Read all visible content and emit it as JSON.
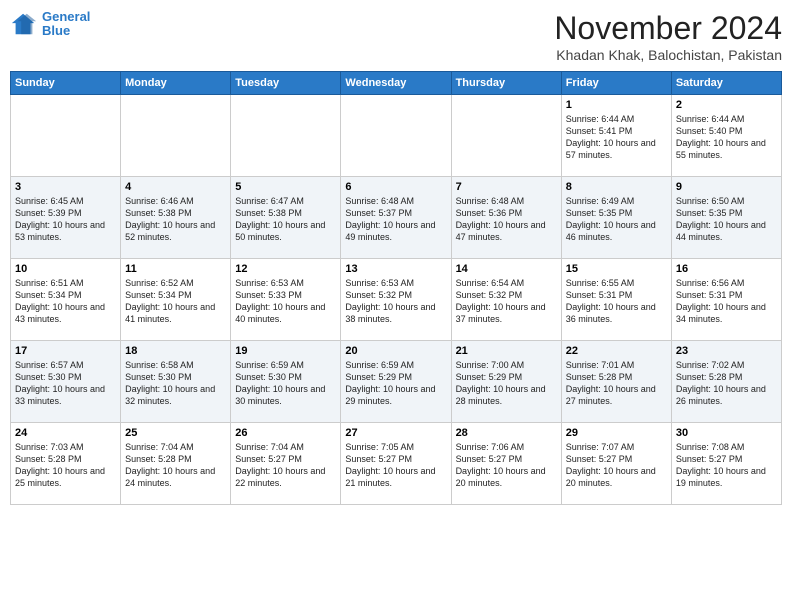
{
  "header": {
    "logo_line1": "General",
    "logo_line2": "Blue",
    "title": "November 2024",
    "subtitle": "Khadan Khak, Balochistan, Pakistan"
  },
  "weekdays": [
    "Sunday",
    "Monday",
    "Tuesday",
    "Wednesday",
    "Thursday",
    "Friday",
    "Saturday"
  ],
  "weeks": [
    [
      {
        "day": "",
        "info": ""
      },
      {
        "day": "",
        "info": ""
      },
      {
        "day": "",
        "info": ""
      },
      {
        "day": "",
        "info": ""
      },
      {
        "day": "",
        "info": ""
      },
      {
        "day": "1",
        "info": "Sunrise: 6:44 AM\nSunset: 5:41 PM\nDaylight: 10 hours and 57 minutes."
      },
      {
        "day": "2",
        "info": "Sunrise: 6:44 AM\nSunset: 5:40 PM\nDaylight: 10 hours and 55 minutes."
      }
    ],
    [
      {
        "day": "3",
        "info": "Sunrise: 6:45 AM\nSunset: 5:39 PM\nDaylight: 10 hours and 53 minutes."
      },
      {
        "day": "4",
        "info": "Sunrise: 6:46 AM\nSunset: 5:38 PM\nDaylight: 10 hours and 52 minutes."
      },
      {
        "day": "5",
        "info": "Sunrise: 6:47 AM\nSunset: 5:38 PM\nDaylight: 10 hours and 50 minutes."
      },
      {
        "day": "6",
        "info": "Sunrise: 6:48 AM\nSunset: 5:37 PM\nDaylight: 10 hours and 49 minutes."
      },
      {
        "day": "7",
        "info": "Sunrise: 6:48 AM\nSunset: 5:36 PM\nDaylight: 10 hours and 47 minutes."
      },
      {
        "day": "8",
        "info": "Sunrise: 6:49 AM\nSunset: 5:35 PM\nDaylight: 10 hours and 46 minutes."
      },
      {
        "day": "9",
        "info": "Sunrise: 6:50 AM\nSunset: 5:35 PM\nDaylight: 10 hours and 44 minutes."
      }
    ],
    [
      {
        "day": "10",
        "info": "Sunrise: 6:51 AM\nSunset: 5:34 PM\nDaylight: 10 hours and 43 minutes."
      },
      {
        "day": "11",
        "info": "Sunrise: 6:52 AM\nSunset: 5:34 PM\nDaylight: 10 hours and 41 minutes."
      },
      {
        "day": "12",
        "info": "Sunrise: 6:53 AM\nSunset: 5:33 PM\nDaylight: 10 hours and 40 minutes."
      },
      {
        "day": "13",
        "info": "Sunrise: 6:53 AM\nSunset: 5:32 PM\nDaylight: 10 hours and 38 minutes."
      },
      {
        "day": "14",
        "info": "Sunrise: 6:54 AM\nSunset: 5:32 PM\nDaylight: 10 hours and 37 minutes."
      },
      {
        "day": "15",
        "info": "Sunrise: 6:55 AM\nSunset: 5:31 PM\nDaylight: 10 hours and 36 minutes."
      },
      {
        "day": "16",
        "info": "Sunrise: 6:56 AM\nSunset: 5:31 PM\nDaylight: 10 hours and 34 minutes."
      }
    ],
    [
      {
        "day": "17",
        "info": "Sunrise: 6:57 AM\nSunset: 5:30 PM\nDaylight: 10 hours and 33 minutes."
      },
      {
        "day": "18",
        "info": "Sunrise: 6:58 AM\nSunset: 5:30 PM\nDaylight: 10 hours and 32 minutes."
      },
      {
        "day": "19",
        "info": "Sunrise: 6:59 AM\nSunset: 5:30 PM\nDaylight: 10 hours and 30 minutes."
      },
      {
        "day": "20",
        "info": "Sunrise: 6:59 AM\nSunset: 5:29 PM\nDaylight: 10 hours and 29 minutes."
      },
      {
        "day": "21",
        "info": "Sunrise: 7:00 AM\nSunset: 5:29 PM\nDaylight: 10 hours and 28 minutes."
      },
      {
        "day": "22",
        "info": "Sunrise: 7:01 AM\nSunset: 5:28 PM\nDaylight: 10 hours and 27 minutes."
      },
      {
        "day": "23",
        "info": "Sunrise: 7:02 AM\nSunset: 5:28 PM\nDaylight: 10 hours and 26 minutes."
      }
    ],
    [
      {
        "day": "24",
        "info": "Sunrise: 7:03 AM\nSunset: 5:28 PM\nDaylight: 10 hours and 25 minutes."
      },
      {
        "day": "25",
        "info": "Sunrise: 7:04 AM\nSunset: 5:28 PM\nDaylight: 10 hours and 24 minutes."
      },
      {
        "day": "26",
        "info": "Sunrise: 7:04 AM\nSunset: 5:27 PM\nDaylight: 10 hours and 22 minutes."
      },
      {
        "day": "27",
        "info": "Sunrise: 7:05 AM\nSunset: 5:27 PM\nDaylight: 10 hours and 21 minutes."
      },
      {
        "day": "28",
        "info": "Sunrise: 7:06 AM\nSunset: 5:27 PM\nDaylight: 10 hours and 20 minutes."
      },
      {
        "day": "29",
        "info": "Sunrise: 7:07 AM\nSunset: 5:27 PM\nDaylight: 10 hours and 20 minutes."
      },
      {
        "day": "30",
        "info": "Sunrise: 7:08 AM\nSunset: 5:27 PM\nDaylight: 10 hours and 19 minutes."
      }
    ]
  ]
}
